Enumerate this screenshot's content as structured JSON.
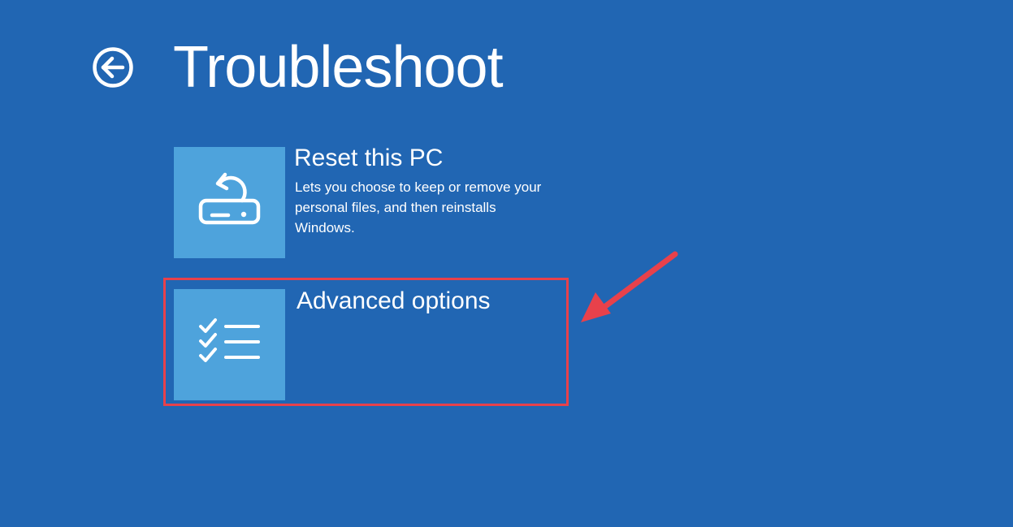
{
  "screen": {
    "title": "Troubleshoot",
    "background_color": "#2166b3"
  },
  "back_button": {
    "icon": "arrow-left-circle-icon"
  },
  "options": [
    {
      "id": "reset",
      "icon": "reset-pc-icon",
      "title": "Reset this PC",
      "description": "Lets you choose to keep or remove your personal files, and then reinstalls Windows."
    },
    {
      "id": "advanced",
      "icon": "checklist-icon",
      "title": "Advanced options",
      "description": ""
    }
  ],
  "annotation": {
    "highlight_color": "#e8414b",
    "highlighted_option": "Advanced options"
  },
  "tile_color": "#4ea3dc"
}
